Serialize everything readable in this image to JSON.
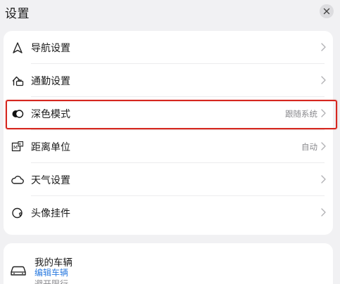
{
  "header": {
    "title": "设置",
    "close_icon": "close-icon"
  },
  "settings": {
    "items": [
      {
        "label": "导航设置",
        "value": "",
        "icon": "navigation-arrow-icon"
      },
      {
        "label": "通勤设置",
        "value": "",
        "icon": "commute-briefcase-icon"
      },
      {
        "label": "深色模式",
        "value": "跟随系统",
        "icon": "dark-mode-icon"
      },
      {
        "label": "距离单位",
        "value": "自动",
        "icon": "distance-unit-icon"
      },
      {
        "label": "天气设置",
        "value": "",
        "icon": "cloud-icon"
      },
      {
        "label": "头像挂件",
        "value": "",
        "icon": "avatar-pendant-icon"
      }
    ]
  },
  "vehicle": {
    "title": "我的车辆",
    "edit_link": "编辑车辆",
    "subtitle": "避开限行",
    "icon": "car-icon"
  },
  "colors": {
    "accent_link": "#2d7ce0",
    "highlight_border": "#d6271f",
    "background": "#f1f1f3"
  }
}
